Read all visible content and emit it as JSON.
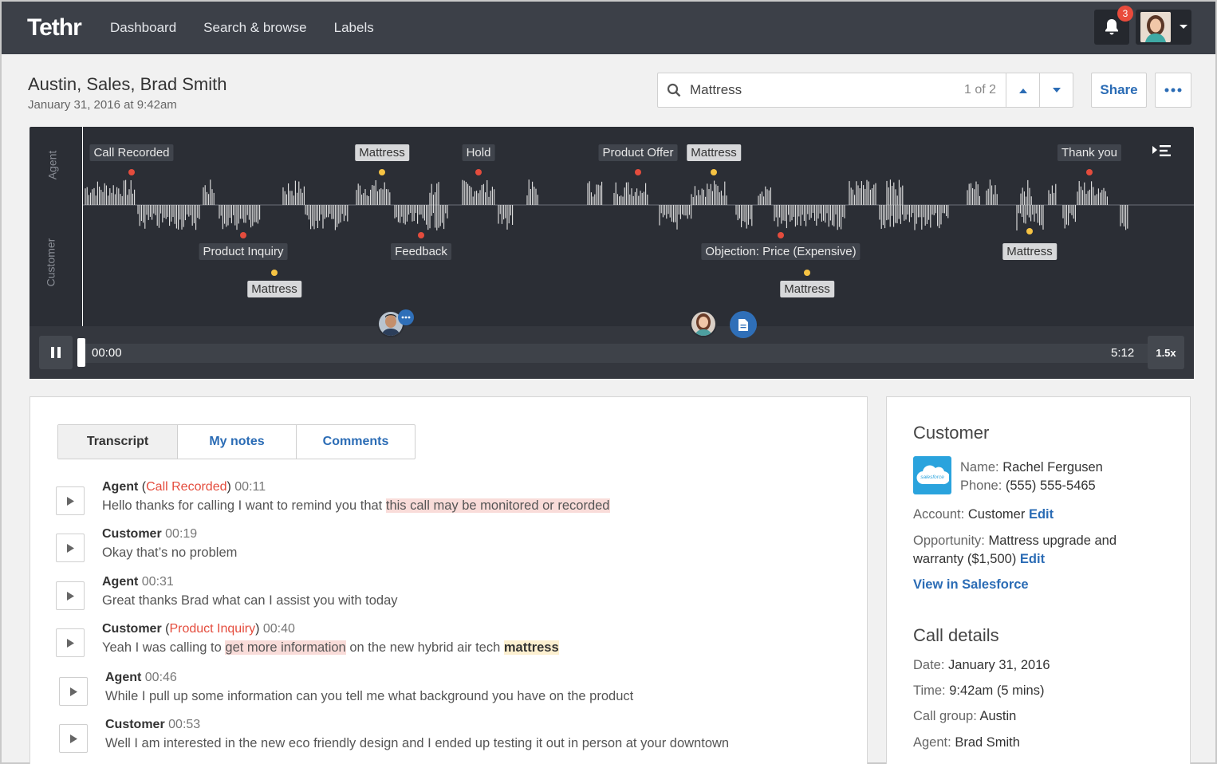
{
  "app": {
    "logo": "Tethr"
  },
  "nav": {
    "items": [
      "Dashboard",
      "Search & browse",
      "Labels"
    ],
    "notification_count": "3"
  },
  "call": {
    "title": "Austin, Sales, Brad Smith",
    "date": "January 31, 2016 at 9:42am"
  },
  "search": {
    "query": "Mattress",
    "count": "1 of 2"
  },
  "actions": {
    "share": "Share"
  },
  "player": {
    "lanes": {
      "agent": "Agent",
      "customer": "Customer"
    },
    "agent_markers": [
      {
        "label": "Call Recorded",
        "kind": "event"
      },
      {
        "label": "Mattress",
        "kind": "keyword"
      },
      {
        "label": "Hold",
        "kind": "event"
      },
      {
        "label": "Product Offer",
        "kind": "event"
      },
      {
        "label": "Mattress",
        "kind": "keyword"
      },
      {
        "label": "Thank you",
        "kind": "event"
      }
    ],
    "customer_markers": [
      {
        "label": "Product Inquiry",
        "kind": "event"
      },
      {
        "label": "Mattress",
        "kind": "keyword"
      },
      {
        "label": "Feedback",
        "kind": "event"
      },
      {
        "label": "Objection: Price (Expensive)",
        "kind": "event"
      },
      {
        "label": "Mattress",
        "kind": "keyword"
      },
      {
        "label": "Mattress",
        "kind": "keyword"
      }
    ],
    "current_time": "00:00",
    "duration": "5:12",
    "speed": "1.5x",
    "progress_fraction": 0.0
  },
  "tabs": {
    "transcript": "Transcript",
    "notes": "My notes",
    "comments": "Comments"
  },
  "transcript": [
    {
      "speaker": "Agent",
      "tag": "Call Recorded",
      "time": "00:11",
      "parts": [
        {
          "t": "Hello thanks for calling I want to remind you that "
        },
        {
          "t": "this call may be monitored or recorded",
          "hl": "red"
        }
      ]
    },
    {
      "speaker": "Customer",
      "tag": "",
      "time": "00:19",
      "parts": [
        {
          "t": "Okay that’s no problem"
        }
      ]
    },
    {
      "speaker": "Agent",
      "tag": "",
      "time": "00:31",
      "parts": [
        {
          "t": "Great thanks Brad what can I assist you with today"
        }
      ]
    },
    {
      "speaker": "Customer",
      "tag": "Product Inquiry",
      "time": "00:40",
      "parts": [
        {
          "t": "Yeah I was calling to "
        },
        {
          "t": "get more information",
          "hl": "red"
        },
        {
          "t": " on the new hybrid air tech "
        },
        {
          "t": "mattress",
          "hl": "yellow"
        }
      ]
    },
    {
      "speaker": "Agent",
      "tag": "",
      "time": "00:46",
      "parts": [
        {
          "t": "While I pull up some information can you tell me what background you have on the product"
        }
      ]
    },
    {
      "speaker": "Customer",
      "tag": "",
      "time": "00:53",
      "parts": [
        {
          "t": "Well I am interested in the new eco friendly design and I ended up testing it out in person at your downtown"
        }
      ]
    }
  ],
  "customer": {
    "heading": "Customer",
    "name_label": "Name:",
    "name": "Rachel Fergusen",
    "phone_label": "Phone:",
    "phone": "(555) 555-5465",
    "account_label": "Account:",
    "account": "Customer",
    "edit": "Edit",
    "opportunity_label": "Opportunity:",
    "opportunity_line1": "Mattress upgrade and",
    "opportunity_line2": "warranty ($1,500)",
    "salesforce_link": "View in Salesforce",
    "salesforce_logo_text": "salesforce"
  },
  "call_details": {
    "heading": "Call details",
    "date_label": "Date:",
    "date": "January 31, 2016",
    "time_label": "Time:",
    "time": "9:42am (5 mins)",
    "group_label": "Call group:",
    "group": "Austin",
    "agent_label": "Agent:",
    "agent": "Brad Smith"
  },
  "colors": {
    "nav_bg": "#3c4048",
    "player_bg": "#2b2e35",
    "link": "#2b6cb5",
    "event_red": "#e44c3d",
    "keyword_yellow": "#f6c343"
  }
}
